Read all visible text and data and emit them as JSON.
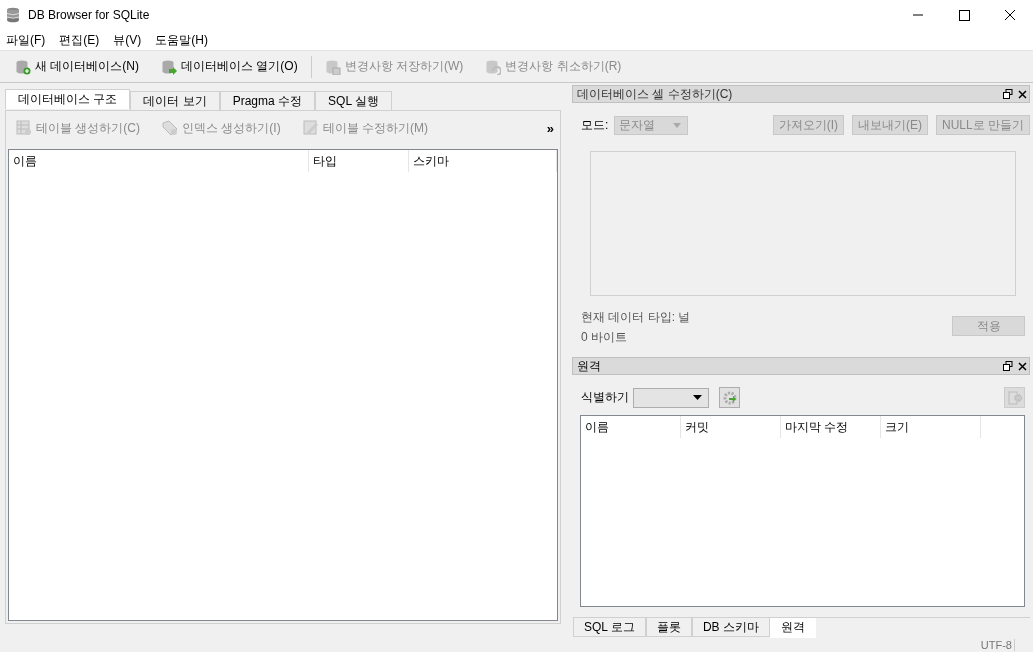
{
  "window": {
    "title": "DB Browser for SQLite"
  },
  "menu": [
    "파일(F)",
    "편집(E)",
    "뷰(V)",
    "도움말(H)"
  ],
  "toolbar": [
    {
      "label": "새 데이터베이스(N)",
      "kind": "new",
      "disabled": false
    },
    {
      "label": "데이터베이스 열기(O)",
      "kind": "open",
      "disabled": false
    },
    {
      "label": "변경사항 저장하기(W)",
      "kind": "save",
      "disabled": true
    },
    {
      "label": "변경사항 취소하기(R)",
      "kind": "revert",
      "disabled": true
    }
  ],
  "main_tabs": [
    {
      "label": "데이터베이스 구조",
      "selected": true
    },
    {
      "label": "데이터 보기",
      "selected": false
    },
    {
      "label": "Pragma 수정",
      "selected": false
    },
    {
      "label": "SQL 실행",
      "selected": false
    }
  ],
  "structure_toolbar": {
    "actions": [
      {
        "label": "테이블 생성하기(C)",
        "kind": "table",
        "disabled": true
      },
      {
        "label": "인덱스 생성하기(I)",
        "kind": "tag",
        "disabled": true
      },
      {
        "label": "테이블 수정하기(M)",
        "kind": "edit",
        "disabled": true
      }
    ],
    "overflow": "»"
  },
  "structure_tree": {
    "columns": [
      "이름",
      "타입",
      "스키마"
    ]
  },
  "edit_cell": {
    "title": "데이터베이스 셀 수정하기(C)",
    "mode_label": "모드:",
    "mode_value": "문자열",
    "mode_disabled": true,
    "buttons": [
      {
        "label": "가져오기(I)",
        "disabled": true
      },
      {
        "label": "내보내기(E)",
        "disabled": true
      },
      {
        "label": "NULL로 만들기",
        "disabled": true
      }
    ],
    "data_type": "현재 데이터 타입: 널",
    "size": "0 바이트",
    "apply": {
      "label": "적용",
      "disabled": true
    }
  },
  "remote": {
    "title": "원격",
    "identity_label": "식별하기",
    "columns": [
      "이름",
      "커밋",
      "마지막 수정",
      "크기"
    ]
  },
  "bottom_tabs": [
    {
      "label": "SQL 로그",
      "selected": false
    },
    {
      "label": "플롯",
      "selected": false
    },
    {
      "label": "DB 스키마",
      "selected": false
    },
    {
      "label": "원격",
      "selected": true
    }
  ],
  "status_bar": {
    "encoding": "UTF-8"
  }
}
